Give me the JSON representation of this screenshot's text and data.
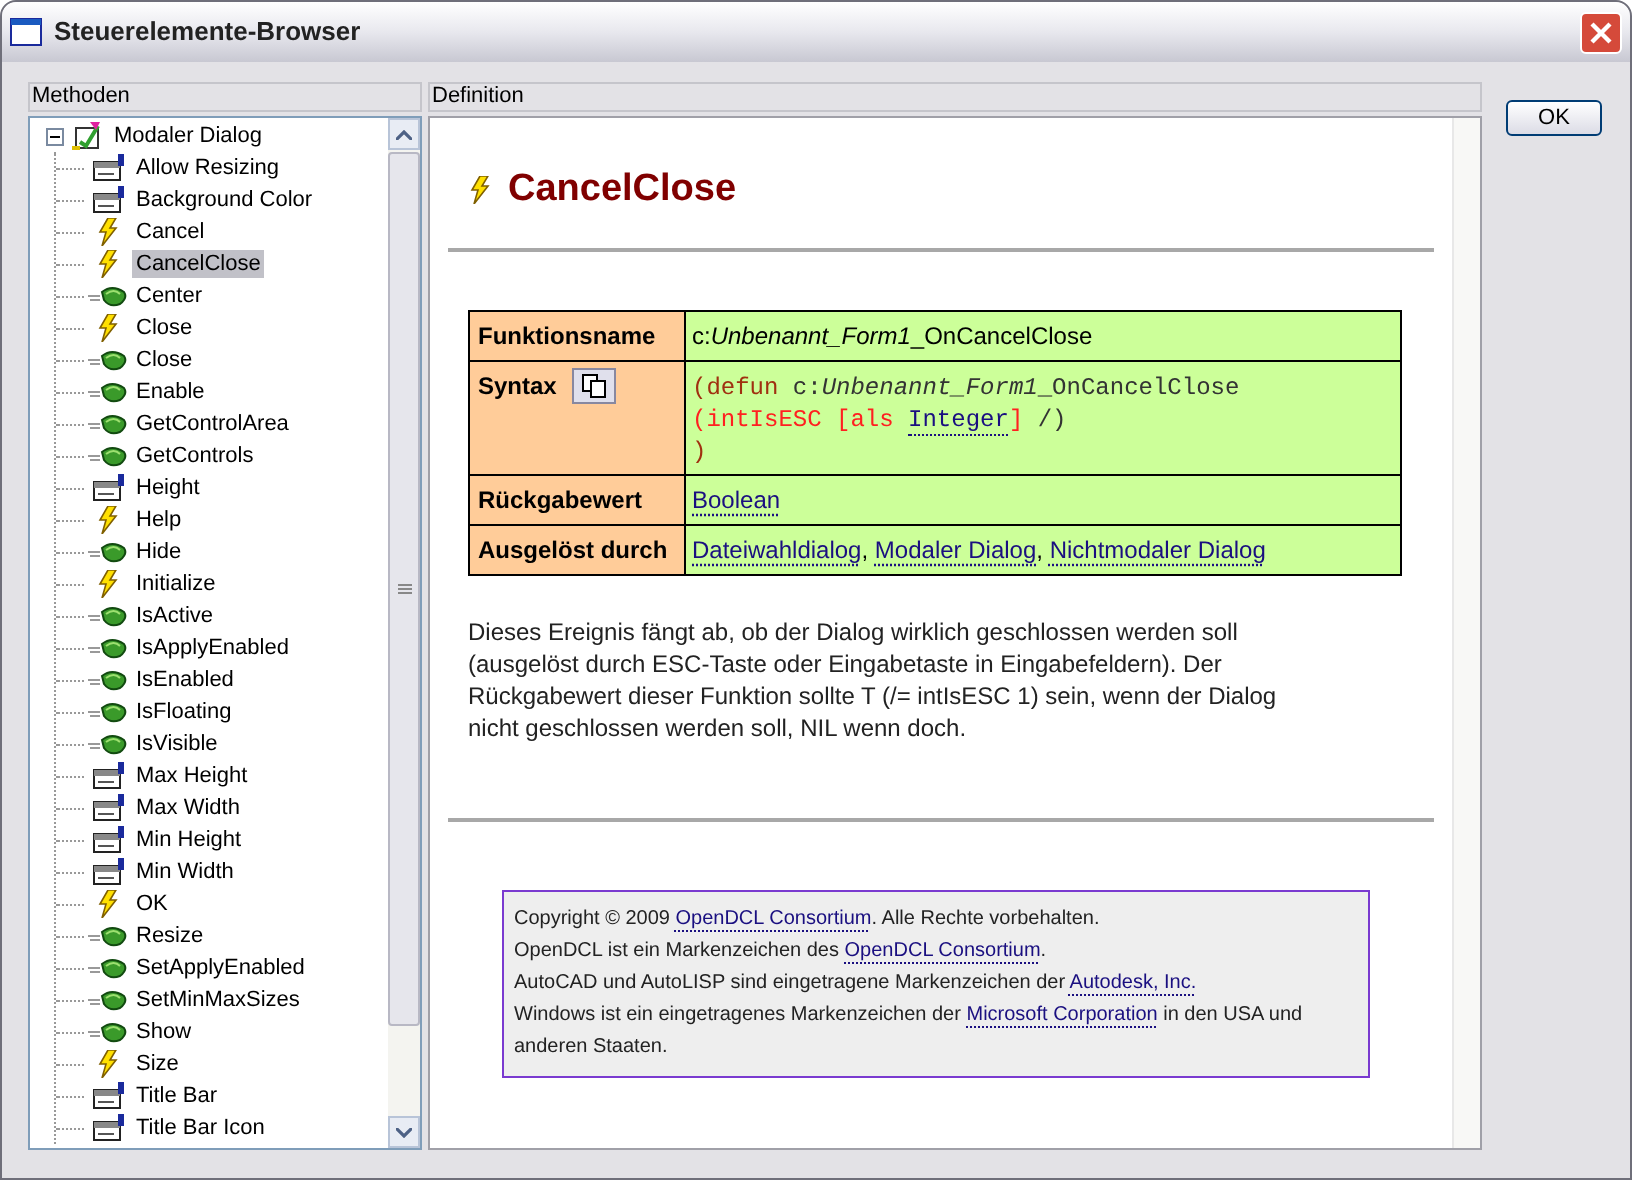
{
  "window": {
    "title": "Steuerelemente-Browser"
  },
  "methods_panel": {
    "header": "Methoden",
    "tree": {
      "label": "Modaler Dialog",
      "expanded": true,
      "children": [
        {
          "label": "Allow Resizing",
          "kind": "property",
          "selected": false
        },
        {
          "label": "Background Color",
          "kind": "property",
          "selected": false
        },
        {
          "label": "Cancel",
          "kind": "event",
          "selected": false
        },
        {
          "label": "CancelClose",
          "kind": "event",
          "selected": true
        },
        {
          "label": "Center",
          "kind": "method",
          "selected": false
        },
        {
          "label": "Close",
          "kind": "event",
          "selected": false
        },
        {
          "label": "Close",
          "kind": "method",
          "selected": false
        },
        {
          "label": "Enable",
          "kind": "method",
          "selected": false
        },
        {
          "label": "GetControlArea",
          "kind": "method",
          "selected": false
        },
        {
          "label": "GetControls",
          "kind": "method",
          "selected": false
        },
        {
          "label": "Height",
          "kind": "property",
          "selected": false
        },
        {
          "label": "Help",
          "kind": "event",
          "selected": false
        },
        {
          "label": "Hide",
          "kind": "method",
          "selected": false
        },
        {
          "label": "Initialize",
          "kind": "event",
          "selected": false
        },
        {
          "label": "IsActive",
          "kind": "method",
          "selected": false
        },
        {
          "label": "IsApplyEnabled",
          "kind": "method",
          "selected": false
        },
        {
          "label": "IsEnabled",
          "kind": "method",
          "selected": false
        },
        {
          "label": "IsFloating",
          "kind": "method",
          "selected": false
        },
        {
          "label": "IsVisible",
          "kind": "method",
          "selected": false
        },
        {
          "label": "Max Height",
          "kind": "property",
          "selected": false
        },
        {
          "label": "Max Width",
          "kind": "property",
          "selected": false
        },
        {
          "label": "Min Height",
          "kind": "property",
          "selected": false
        },
        {
          "label": "Min Width",
          "kind": "property",
          "selected": false
        },
        {
          "label": "OK",
          "kind": "event",
          "selected": false
        },
        {
          "label": "Resize",
          "kind": "method",
          "selected": false
        },
        {
          "label": "SetApplyEnabled",
          "kind": "method",
          "selected": false
        },
        {
          "label": "SetMinMaxSizes",
          "kind": "method",
          "selected": false
        },
        {
          "label": "Show",
          "kind": "method",
          "selected": false
        },
        {
          "label": "Size",
          "kind": "event",
          "selected": false
        },
        {
          "label": "Title Bar",
          "kind": "property",
          "selected": false
        },
        {
          "label": "Title Bar Icon",
          "kind": "property",
          "selected": false
        }
      ]
    }
  },
  "definition_panel": {
    "header": "Definition",
    "title": "CancelClose",
    "table": [
      {
        "label": "Funktionsname",
        "kind": "links",
        "segments": [
          {
            "text": "c:",
            "kind": "text"
          },
          {
            "text": "Unbenannt_Form1",
            "kind": "italic"
          },
          {
            "text": "_OnCancelClose",
            "kind": "text"
          }
        ]
      },
      {
        "label": "Syntax",
        "kind": "code",
        "lines": [
          [
            {
              "text": "(defun ",
              "kind": "keyword"
            },
            {
              "text": "c:",
              "kind": "plain"
            },
            {
              "text": "Unbenannt_Form1",
              "kind": "italic"
            },
            {
              "text": "_OnCancelClose",
              "kind": "plain"
            }
          ],
          [
            {
              "text": "(intIsESC [als ",
              "kind": "param"
            },
            {
              "text": "Integer",
              "kind": "link"
            },
            {
              "text": "] ",
              "kind": "param"
            },
            {
              "text": "/)",
              "kind": "plain"
            }
          ],
          [
            {
              "text": ")",
              "kind": "keyword"
            }
          ]
        ]
      },
      {
        "label": "Rückgabewert",
        "kind": "links",
        "segments": [
          {
            "text": "Boolean",
            "kind": "link"
          }
        ]
      },
      {
        "label": "Ausgelöst durch",
        "kind": "links",
        "segments": [
          {
            "text": "Dateiwahldialog",
            "kind": "link",
            "after": ","
          },
          {
            "text": "Modaler Dialog",
            "kind": "link",
            "after": ","
          },
          {
            "text": "Nichtmodaler Dialog",
            "kind": "link"
          }
        ]
      }
    ],
    "description": "Dieses Ereignis fängt ab, ob der Dialog wirklich geschlossen werden soll (ausgelöst durch ESC-Taste oder Eingabetaste in Eingabefeldern). Der Rückgabewert dieser Funktion sollte T (/= intIsESC 1) sein, wenn der Dialog nicht geschlossen werden soll, NIL wenn doch.",
    "footer": [
      [
        {
          "text": "Copyright © 2009 ",
          "kind": "text"
        },
        {
          "text": "OpenDCL Consortium",
          "kind": "link"
        },
        {
          "text": ". Alle Rechte vorbehalten.",
          "kind": "text"
        }
      ],
      [
        {
          "text": "OpenDCL ist ein Markenzeichen des ",
          "kind": "text"
        },
        {
          "text": "OpenDCL Consortium",
          "kind": "link"
        },
        {
          "text": ".",
          "kind": "text"
        }
      ],
      [
        {
          "text": "AutoCAD und AutoLISP sind eingetragene Markenzeichen der ",
          "kind": "text"
        },
        {
          "text": "Autodesk, Inc.",
          "kind": "link"
        }
      ],
      [
        {
          "text": "Windows ist ein eingetragenes Markenzeichen der ",
          "kind": "text"
        },
        {
          "text": "Microsoft Corporation",
          "kind": "link"
        },
        {
          "text": " in den USA und anderen Staaten.",
          "kind": "text"
        }
      ]
    ]
  },
  "buttons": [
    {
      "label": "OK"
    }
  ]
}
